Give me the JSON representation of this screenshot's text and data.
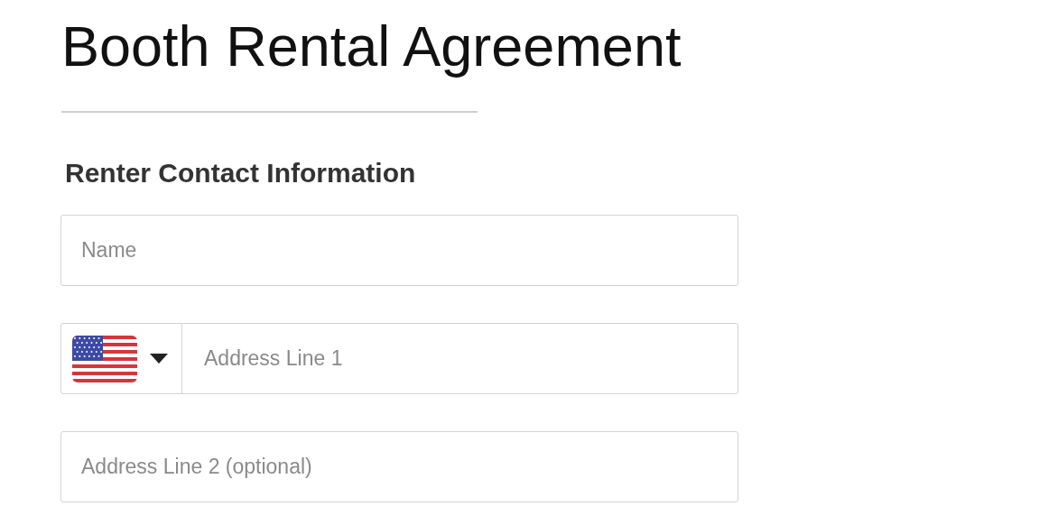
{
  "title": "Booth Rental Agreement",
  "section": {
    "heading": "Renter Contact Information"
  },
  "fields": [
    {
      "kind": "text",
      "placeholder": "Name"
    },
    {
      "kind": "country-text",
      "placeholder": "Address Line 1"
    },
    {
      "kind": "text",
      "placeholder": "Address Line 2 (optional)"
    }
  ]
}
